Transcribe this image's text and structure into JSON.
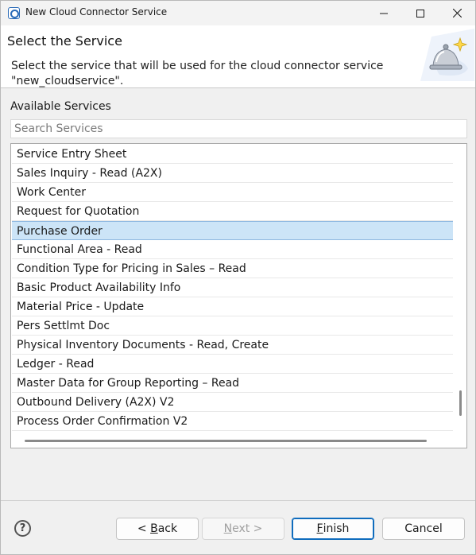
{
  "window": {
    "title": "New Cloud Connector Service"
  },
  "header": {
    "title": "Select the Service",
    "description": "Select the service that will be used for the cloud connector service \"new_cloudservice\"."
  },
  "services": {
    "label": "Available Services",
    "search_placeholder": "Search Services",
    "search_value": "",
    "items": [
      "Service Entry Sheet",
      "Sales Inquiry - Read (A2X)",
      "Work Center",
      "Request for Quotation",
      "Purchase Order",
      "Functional Area - Read",
      "Condition Type for Pricing in Sales – Read",
      "Basic Product Availability Info",
      "Material Price - Update",
      "Pers Settlmt Doc",
      "Physical Inventory Documents - Read, Create",
      "Ledger - Read",
      "Master Data for Group Reporting – Read",
      "Outbound Delivery (A2X) V2",
      "Process Order Confirmation V2"
    ],
    "selected_index": 4,
    "vertical_scroll_position": 0.93,
    "horizontal_scroll_position": 0.0
  },
  "buttons": {
    "back_prefix": "< ",
    "back_mnemonic": "B",
    "back_rest": "ack",
    "next_mnemonic": "N",
    "next_rest": "ext >",
    "finish_mnemonic": "F",
    "finish_rest": "inish",
    "cancel": "Cancel",
    "help": "?"
  },
  "colors": {
    "selection": "#cce4f7",
    "default_button_border": "#0f6cbd"
  }
}
